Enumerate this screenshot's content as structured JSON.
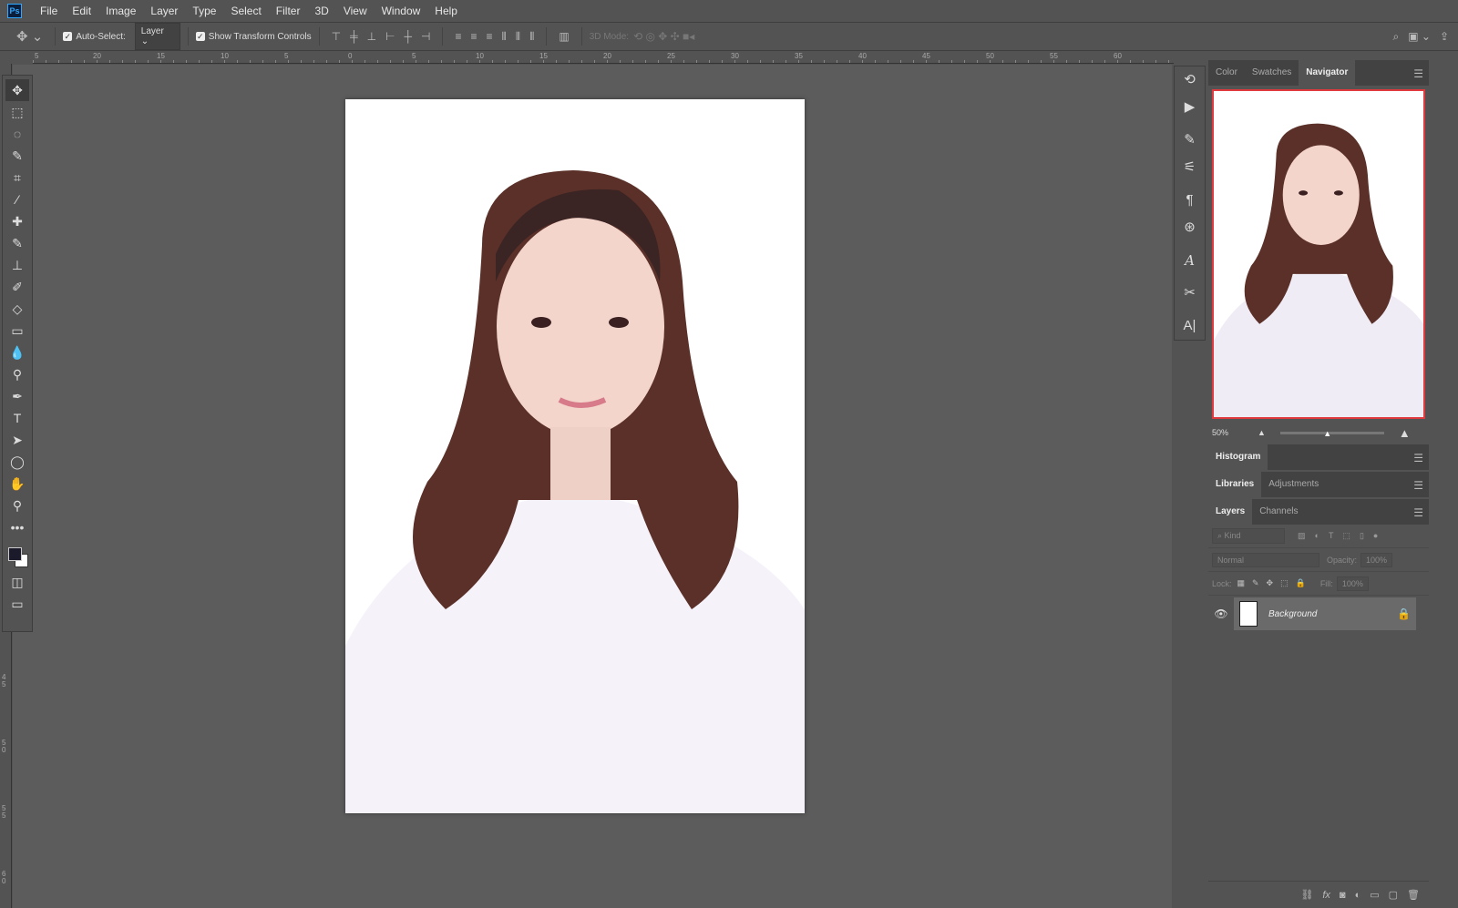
{
  "app": {
    "logo": "Ps"
  },
  "menu": [
    "File",
    "Edit",
    "Image",
    "Layer",
    "Type",
    "Select",
    "Filter",
    "3D",
    "View",
    "Window",
    "Help"
  ],
  "options": {
    "auto_select_label": "Auto-Select:",
    "auto_select_checked": true,
    "layer_select": "Layer",
    "show_transform_label": "Show Transform Controls",
    "show_transform_checked": true,
    "mode_3d_label": "3D Mode:"
  },
  "ruler": {
    "h_labels": [
      "5",
      "20",
      "15",
      "10",
      "5",
      "0",
      "5",
      "10",
      "15",
      "20",
      "25",
      "30",
      "35",
      "40",
      "45",
      "50",
      "55",
      "60"
    ],
    "v_labels": [
      "4 5",
      "5 0",
      "5 5",
      "6 0"
    ]
  },
  "tools": [
    "move-icon",
    "marquee-icon",
    "lasso-icon",
    "quick-select-icon",
    "crop-icon",
    "eyedropper-icon",
    "healing-icon",
    "brush-icon",
    "stamp-icon",
    "history-brush-icon",
    "eraser-icon",
    "gradient-icon",
    "blur-icon",
    "dodge-icon",
    "pen-icon",
    "type-icon",
    "path-select-icon",
    "ellipse-icon",
    "hand-icon",
    "zoom-icon",
    "more-icon"
  ],
  "colors": {
    "foreground": "#1a1a2a",
    "background": "#ffffff",
    "nav_frame": "#e0393e"
  },
  "panels": {
    "top_tabs": [
      "Color",
      "Swatches",
      "Navigator"
    ],
    "top_active": "Navigator",
    "zoom": "50%",
    "zoom_slider_fraction": 0.45,
    "histogram": "Histogram",
    "lib_tabs": [
      "Libraries",
      "Adjustments"
    ],
    "layer_tabs": [
      "Layers",
      "Channels"
    ],
    "kind": "Kind",
    "blend": "Normal",
    "opacity_label": "Opacity:",
    "opacity": "100%",
    "lock_label": "Lock:",
    "fill_label": "Fill:",
    "fill": "100%",
    "layers": [
      {
        "name": "Background",
        "visible": true,
        "locked": true
      }
    ]
  }
}
